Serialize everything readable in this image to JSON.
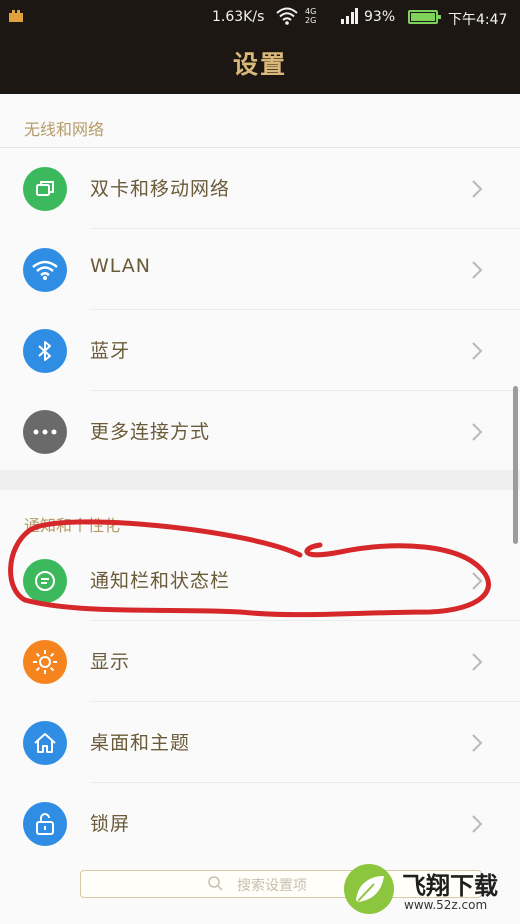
{
  "status_bar": {
    "speed": "1.63K/s",
    "network": "4G 2G",
    "battery": "93%",
    "battery_level": 0.93,
    "time": "下午4:47",
    "battery_color": "#7fd35b"
  },
  "title": "设置",
  "sections": [
    {
      "header": "无线和网络",
      "items": [
        {
          "label": "双卡和移动网络",
          "icon": "sim-card-icon",
          "color": "#3cb95c"
        },
        {
          "label": "WLAN",
          "icon": "wifi-icon",
          "color": "#2f8de4"
        },
        {
          "label": "蓝牙",
          "icon": "bluetooth-icon",
          "color": "#2f8de4"
        },
        {
          "label": "更多连接方式",
          "icon": "more-dots-icon",
          "color": "#6a6a6a"
        }
      ]
    },
    {
      "header": "通知和个性化",
      "items": [
        {
          "label": "通知栏和状态栏",
          "icon": "notification-icon",
          "color": "#3cb95c"
        },
        {
          "label": "显示",
          "icon": "brightness-icon",
          "color": "#f5841f"
        },
        {
          "label": "桌面和主题",
          "icon": "home-icon",
          "color": "#2f8de4"
        },
        {
          "label": "锁屏",
          "icon": "lock-icon",
          "color": "#2f8de4"
        }
      ]
    }
  ],
  "search": {
    "placeholder": "搜索设置项"
  },
  "watermark": {
    "brand": "飞翔下载",
    "url": "www.52z.com"
  },
  "colors": {
    "header_bg": "#1c1712",
    "title_gold": "#d9b879",
    "annotation_red": "#d6282a"
  }
}
